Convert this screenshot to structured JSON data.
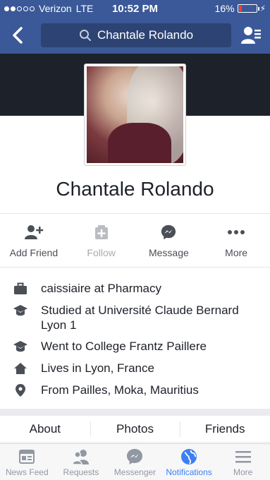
{
  "status": {
    "carrier": "Verizon",
    "network": "LTE",
    "time": "10:52 PM",
    "battery": "16%",
    "battery_level": 0.16,
    "signal_bars": 2
  },
  "nav": {
    "search_text": "Chantale Rolando"
  },
  "profile": {
    "name": "Chantale Rolando"
  },
  "actions": [
    {
      "label": "Add Friend"
    },
    {
      "label": "Follow"
    },
    {
      "label": "Message"
    },
    {
      "label": "More"
    }
  ],
  "intro": [
    {
      "icon": "briefcase-icon",
      "text": "caissiaire at Pharmacy"
    },
    {
      "icon": "graduation-cap-icon",
      "text": "Studied at Université Claude Bernard Lyon 1"
    },
    {
      "icon": "graduation-cap-icon",
      "text": "Went to College Frantz Paillere"
    },
    {
      "icon": "home-icon",
      "text": "Lives in Lyon, France"
    },
    {
      "icon": "location-pin-icon",
      "text": "From Pailles, Moka, Mauritius"
    }
  ],
  "tabs": [
    {
      "label": "About"
    },
    {
      "label": "Photos"
    },
    {
      "label": "Friends"
    }
  ],
  "bottom_nav": [
    {
      "label": "News Feed"
    },
    {
      "label": "Requests"
    },
    {
      "label": "Messenger"
    },
    {
      "label": "Notifications",
      "active": true
    },
    {
      "label": "More"
    }
  ],
  "colors": {
    "brand": "#3b5998",
    "active_tab": "#3b7ff4",
    "battery_low": "#ff3b30"
  }
}
